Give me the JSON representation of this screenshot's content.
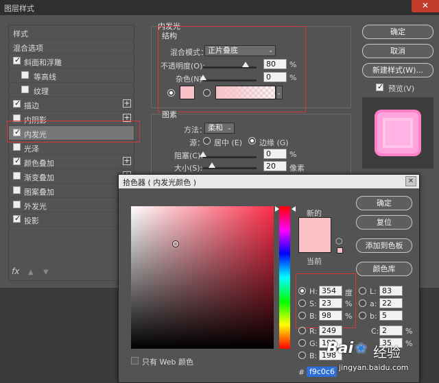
{
  "main_window": {
    "title": "图层样式",
    "close_glyph": "✕"
  },
  "style_list": {
    "items": [
      {
        "label": "样式",
        "checkbox": "none",
        "plus": false,
        "selected": false
      },
      {
        "label": "混合选项",
        "checkbox": "none",
        "plus": false,
        "selected": false
      },
      {
        "label": "斜面和浮雕",
        "checkbox": "checked",
        "plus": false,
        "selected": false
      },
      {
        "label": "等高线",
        "checkbox": "unchecked",
        "plus": false,
        "selected": false,
        "indent": true
      },
      {
        "label": "纹理",
        "checkbox": "unchecked",
        "plus": false,
        "selected": false,
        "indent": true
      },
      {
        "label": "描边",
        "checkbox": "checked",
        "plus": true,
        "selected": false
      },
      {
        "label": "内阴影",
        "checkbox": "unchecked",
        "plus": true,
        "selected": false
      },
      {
        "label": "内发光",
        "checkbox": "checked",
        "plus": false,
        "selected": true
      },
      {
        "label": "光泽",
        "checkbox": "unchecked",
        "plus": false,
        "selected": false
      },
      {
        "label": "颜色叠加",
        "checkbox": "checked",
        "plus": true,
        "selected": false
      },
      {
        "label": "渐变叠加",
        "checkbox": "unchecked",
        "plus": true,
        "selected": false
      },
      {
        "label": "图案叠加",
        "checkbox": "unchecked",
        "plus": false,
        "selected": false
      },
      {
        "label": "外发光",
        "checkbox": "unchecked",
        "plus": false,
        "selected": false
      },
      {
        "label": "投影",
        "checkbox": "checked",
        "plus": true,
        "selected": false
      }
    ],
    "fx_label": "fx",
    "up_glyph": "▲",
    "down_glyph": "▼",
    "plus_glyph": "+"
  },
  "inner_glow": {
    "section_title": "内发光",
    "structure": {
      "title": "结构",
      "blend_mode_label": "混合模式：",
      "blend_mode_value": "正片叠底",
      "opacity_label": "不透明度(O):",
      "opacity_value": "80",
      "opacity_level": 80,
      "noise_label": "杂色(N):",
      "noise_value": "0",
      "noise_level": 0,
      "percent": "%",
      "glow_color": "#f9c0c6"
    },
    "elements": {
      "title": "图素",
      "method_label": "方法：",
      "method_value": "柔和",
      "source_label": "源：",
      "source_center": "居中 (E)",
      "source_edge": "边缘 (G)",
      "choke_label": "阻塞(C):",
      "choke_value": "0",
      "choke_level": 0,
      "size_label": "大小(S):",
      "size_value": "20",
      "size_unit": "像素",
      "percent": "%"
    }
  },
  "right_buttons": {
    "ok": "确定",
    "cancel": "取消",
    "new_style": "新建样式(W)...",
    "preview_label": "预览(V)",
    "preview_color": "#ff8fd4"
  },
  "picker": {
    "title": "拾色器 ( 内发光颜色 )",
    "close_glyph": "✕",
    "new_label": "新的",
    "current_label": "当前",
    "new_color": "#f9c0c6",
    "current_color": "#f9c0c6",
    "buttons": {
      "ok": "确定",
      "reset": "复位",
      "add_to_swatches": "添加到色板",
      "color_libraries": "颜色库"
    },
    "hsb": {
      "h_label": "H:",
      "h_value": "354",
      "h_unit": "度",
      "s_label": "S:",
      "s_value": "23",
      "s_unit": "%",
      "b_label": "B:",
      "b_value": "98",
      "b_unit": "%"
    },
    "rgb": {
      "r_label": "R:",
      "r_value": "249",
      "g_label": "G:",
      "g_value": "192",
      "b_label": "B:",
      "b_value": "198"
    },
    "lab": {
      "l_label": "L:",
      "l_value": "83",
      "a_label": "a:",
      "a_value": "22",
      "b_label": "b:",
      "b_value": "5"
    },
    "cmyk": {
      "c_label": "C:",
      "c_value": "2",
      "c_unit": "%",
      "m_value": "35",
      "m_unit": "%"
    },
    "hex_label": "#",
    "hex_value": "f9c0c6",
    "only_web_label": "只有 Web 颜色"
  },
  "watermark": {
    "brand": "Bai",
    "brand_suffix": "经验",
    "url": "jingyan.baidu.com"
  }
}
